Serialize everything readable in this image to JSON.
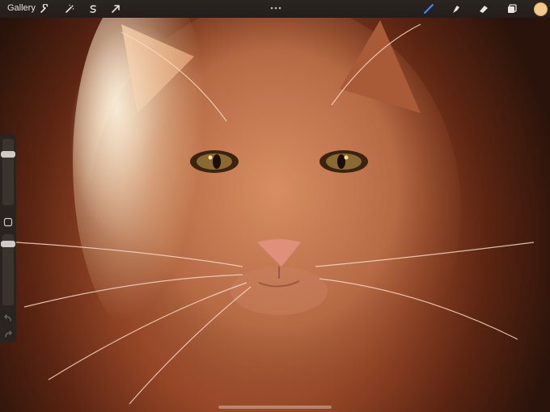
{
  "topbar": {
    "gallery_label": "Gallery",
    "left_tools": [
      "wrench-icon",
      "magic-wand-icon",
      "selection-icon",
      "transform-icon"
    ],
    "right_tools": [
      "brush-icon",
      "smudge-icon",
      "eraser-icon",
      "layers-icon"
    ],
    "more_icon": "ellipsis-icon",
    "active_tool": "brush-icon",
    "active_color": "#f5c88a"
  },
  "sidebar": {
    "brush_size_level": 0.2,
    "opacity_level": 0.1,
    "undo_icon": "undo-icon",
    "redo_icon": "redo-icon"
  },
  "canvas": {
    "subject": "cat-portrait",
    "accent_color": "#3f8cff"
  }
}
